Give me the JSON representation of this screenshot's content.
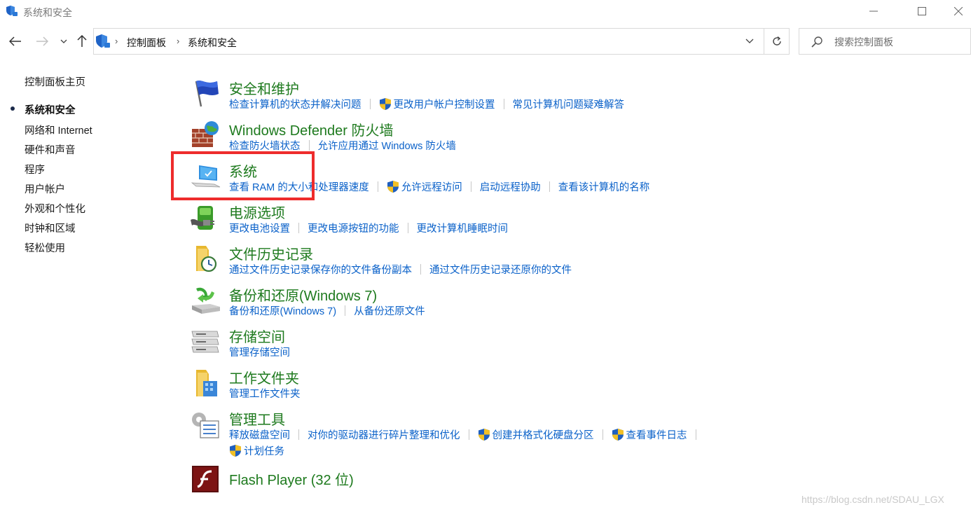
{
  "window": {
    "title": "系统和安全",
    "icon": "control-panel-shield-icon"
  },
  "address": {
    "crumbs": [
      "控制面板",
      "系统和安全"
    ]
  },
  "search": {
    "placeholder": "搜索控制面板"
  },
  "sidebar": {
    "items": [
      {
        "label": "控制面板主页"
      },
      {
        "label": "系统和安全",
        "active": true
      },
      {
        "label": "网络和 Internet"
      },
      {
        "label": "硬件和声音"
      },
      {
        "label": "程序"
      },
      {
        "label": "用户帐户"
      },
      {
        "label": "外观和个性化"
      },
      {
        "label": "时钟和区域"
      },
      {
        "label": "轻松使用"
      }
    ]
  },
  "categories": [
    {
      "title": "安全和维护",
      "icon": "security-flag-icon",
      "links": [
        "检查计算机的状态并解决问题",
        "更改用户帐户控制设置",
        "常见计算机问题疑难解答"
      ]
    },
    {
      "title": "Windows Defender 防火墙",
      "icon": "firewall-icon",
      "links": [
        "检查防火墙状态",
        "允许应用通过 Windows 防火墙"
      ]
    },
    {
      "title": "系统",
      "icon": "system-computer-icon",
      "links": [
        "查看 RAM 的大小和处理器速度",
        "允许远程访问",
        "启动远程协助",
        "查看该计算机的名称"
      ]
    },
    {
      "title": "电源选项",
      "icon": "power-battery-icon",
      "links": [
        "更改电池设置",
        "更改电源按钮的功能",
        "更改计算机睡眠时间"
      ]
    },
    {
      "title": "文件历史记录",
      "icon": "file-history-icon",
      "links": [
        "通过文件历史记录保存你的文件备份副本",
        "通过文件历史记录还原你的文件"
      ]
    },
    {
      "title": "备份和还原(Windows 7)",
      "icon": "backup-restore-icon",
      "links": [
        "备份和还原(Windows 7)",
        "从备份还原文件"
      ]
    },
    {
      "title": "存储空间",
      "icon": "storage-spaces-icon",
      "links": [
        "管理存储空间"
      ]
    },
    {
      "title": "工作文件夹",
      "icon": "work-folders-icon",
      "links": [
        "管理工作文件夹"
      ]
    },
    {
      "title": "管理工具",
      "icon": "admin-tools-icon",
      "links": [
        "释放磁盘空间",
        "对你的驱动器进行碎片整理和优化",
        "创建并格式化硬盘分区",
        "查看事件日志",
        "计划任务"
      ]
    },
    {
      "title": "Flash Player (32 位)",
      "icon": "flash-player-icon",
      "links": []
    }
  ],
  "watermark": "https://blog.csdn.net/SDAU_LGX",
  "colors": {
    "category_title": "#1e7a1e",
    "link": "#0a61c9",
    "highlight_box": "#ee2c2c"
  }
}
